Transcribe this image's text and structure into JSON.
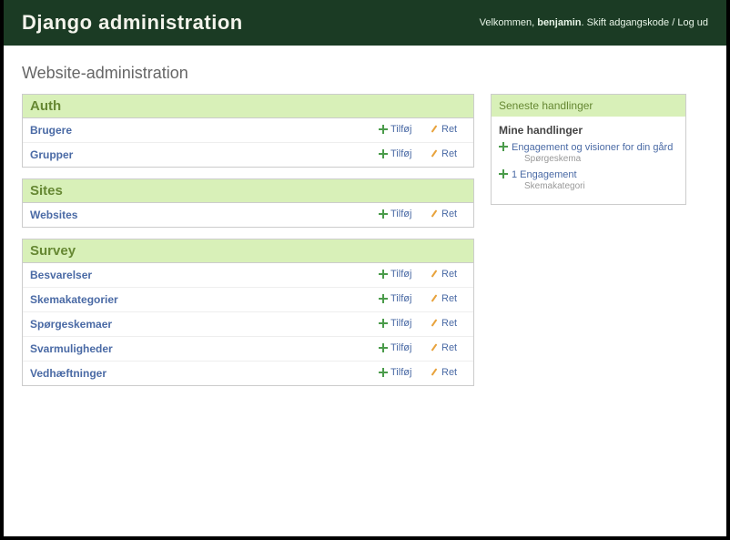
{
  "header": {
    "site_title": "Django administration",
    "welcome": "Velkommen,",
    "username": "benjamin",
    "change_password": "Skift adgangskode",
    "logout": "Log ud"
  },
  "content_title": "Website-administration",
  "action_labels": {
    "add": "Tilføj",
    "change": "Ret"
  },
  "apps": [
    {
      "name": "Auth",
      "models": [
        {
          "name": "Brugere"
        },
        {
          "name": "Grupper"
        }
      ]
    },
    {
      "name": "Sites",
      "models": [
        {
          "name": "Websites"
        }
      ]
    },
    {
      "name": "Survey",
      "models": [
        {
          "name": "Besvarelser"
        },
        {
          "name": "Skemakategorier"
        },
        {
          "name": "Spørgeskemaer"
        },
        {
          "name": "Svarmuligheder"
        },
        {
          "name": "Vedhæftninger"
        }
      ]
    }
  ],
  "recent": {
    "title": "Seneste handlinger",
    "subtitle": "Mine handlinger",
    "items": [
      {
        "text": "Engagement og visioner for din gård",
        "type": "Spørgeskema"
      },
      {
        "text": "1 Engagement",
        "type": "Skemakategori"
      }
    ]
  }
}
